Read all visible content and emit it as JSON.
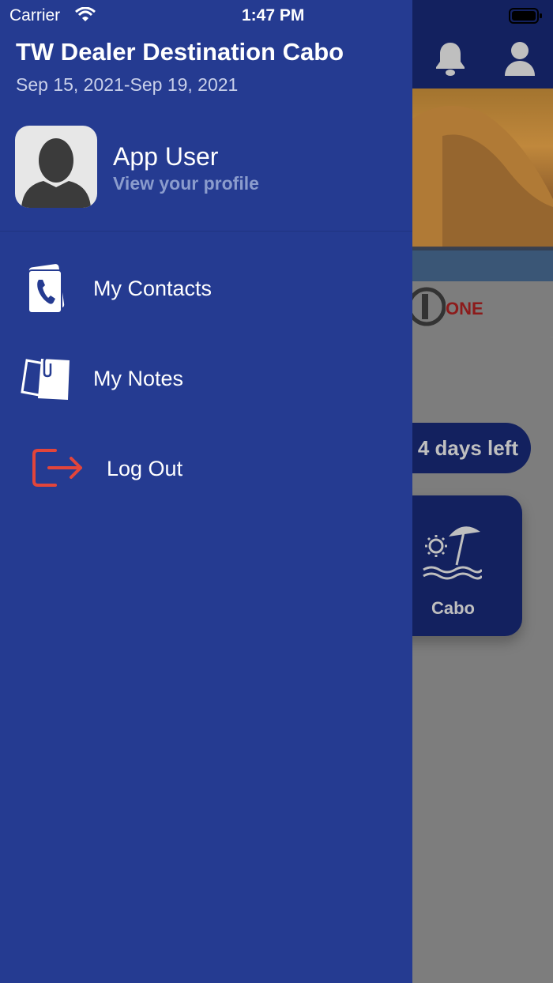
{
  "status_bar": {
    "carrier": "Carrier",
    "time": "1:47 PM"
  },
  "drawer": {
    "event_title": "TW Dealer Destination Cabo",
    "event_dates": "Sep 15, 2021-Sep 19, 2021",
    "user": {
      "name": "App User",
      "view_profile": "View your profile"
    },
    "menu": [
      {
        "label": "My Contacts",
        "icon": "contacts-phone-icon"
      },
      {
        "label": "My Notes",
        "icon": "notes-icon"
      },
      {
        "label": "Log Out",
        "icon": "logout-icon"
      }
    ]
  },
  "background": {
    "logo_text": "ONE",
    "countdown": "4 days left",
    "tile_label": "Cabo"
  },
  "colors": {
    "drawer_bg": "#253b91",
    "header_bg": "#13215f",
    "logout_accent": "#e2453b",
    "subtle_text": "#8b9ccd"
  }
}
